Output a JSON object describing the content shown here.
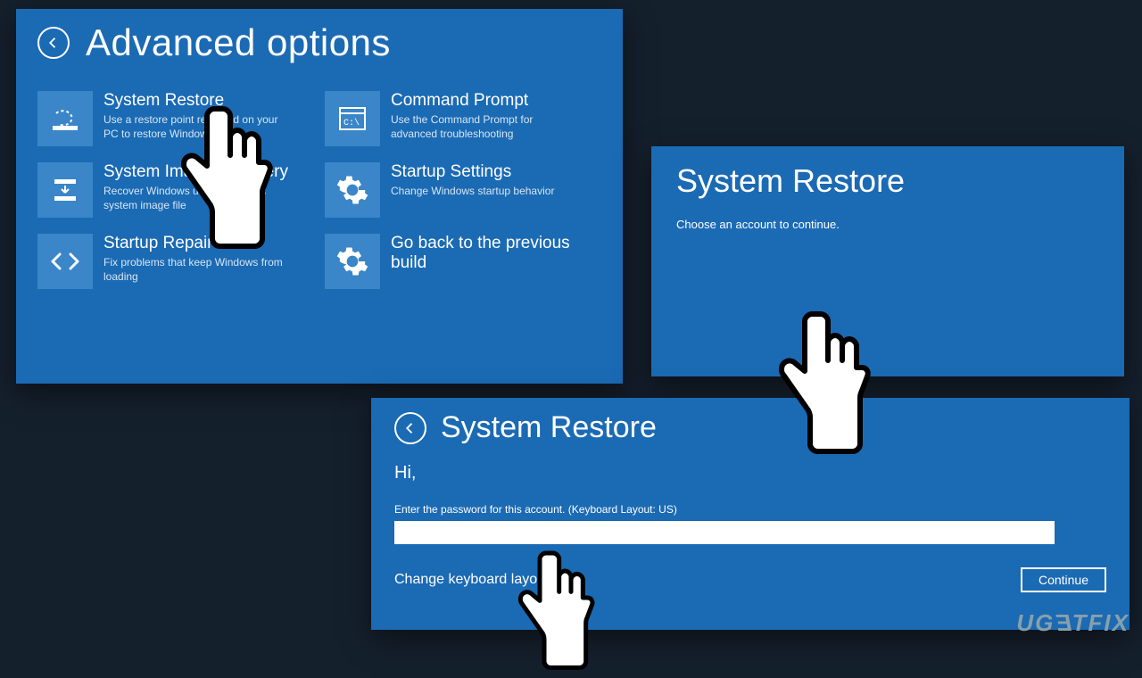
{
  "panel1": {
    "title": "Advanced options",
    "tiles": [
      {
        "title": "System Restore",
        "desc": "Use a restore point recorded on your PC to restore Windows"
      },
      {
        "title": "Command Prompt",
        "desc": "Use the Command Prompt for advanced troubleshooting"
      },
      {
        "title": "System Image Recovery",
        "desc": "Recover Windows using a specific system image file"
      },
      {
        "title": "Startup Settings",
        "desc": "Change Windows startup behavior"
      },
      {
        "title": "Startup Repair",
        "desc": "Fix problems that keep Windows from loading"
      },
      {
        "title": "Go back to the previous build",
        "desc": ""
      }
    ]
  },
  "panel2": {
    "title": "System Restore",
    "subtitle": "Choose an account to continue."
  },
  "panel3": {
    "title": "System Restore",
    "greeting": "Hi,",
    "hint": "Enter the password for this account. (Keyboard Layout: US)",
    "password_value": "",
    "keyboard_link": "Change keyboard layout",
    "continue_label": "Continue"
  },
  "watermark": "UGETFIX"
}
